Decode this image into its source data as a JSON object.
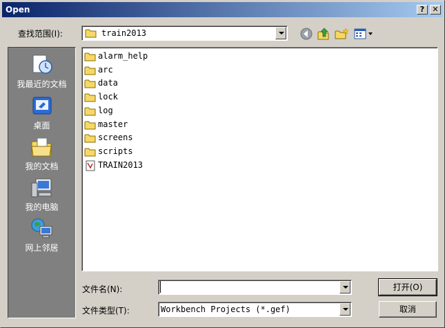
{
  "window": {
    "title": "Open",
    "help_label": "?",
    "close_label": "✕"
  },
  "toolbar": {
    "lookin_label": "查找范围(I):",
    "lookin_value": "train2013",
    "icons": [
      "back-icon",
      "up-folder-icon",
      "new-folder-icon",
      "view-menu-icon"
    ]
  },
  "places": [
    {
      "label": "我最近的文档",
      "icon": "recent-documents-icon"
    },
    {
      "label": "桌面",
      "icon": "desktop-icon"
    },
    {
      "label": "我的文档",
      "icon": "my-documents-icon"
    },
    {
      "label": "我的电脑",
      "icon": "my-computer-icon"
    },
    {
      "label": "网上邻居",
      "icon": "network-places-icon"
    }
  ],
  "files": [
    {
      "name": "alarm_help",
      "type": "folder"
    },
    {
      "name": "arc",
      "type": "folder"
    },
    {
      "name": "data",
      "type": "folder"
    },
    {
      "name": "lock",
      "type": "folder"
    },
    {
      "name": "log",
      "type": "folder"
    },
    {
      "name": "master",
      "type": "folder"
    },
    {
      "name": "screens",
      "type": "folder"
    },
    {
      "name": "scripts",
      "type": "folder"
    },
    {
      "name": "TRAIN2013",
      "type": "file"
    }
  ],
  "form": {
    "filename_label": "文件名(N):",
    "filename_value": "",
    "filetype_label": "文件类型(T):",
    "filetype_value": "Workbench Projects (*.gef)"
  },
  "buttons": {
    "open_label": "打开(O)",
    "cancel_label": "取消"
  },
  "colors": {
    "title_start": "#0a246a",
    "title_end": "#a6caf0",
    "face": "#d4d0c8",
    "places_bg": "#808080"
  }
}
